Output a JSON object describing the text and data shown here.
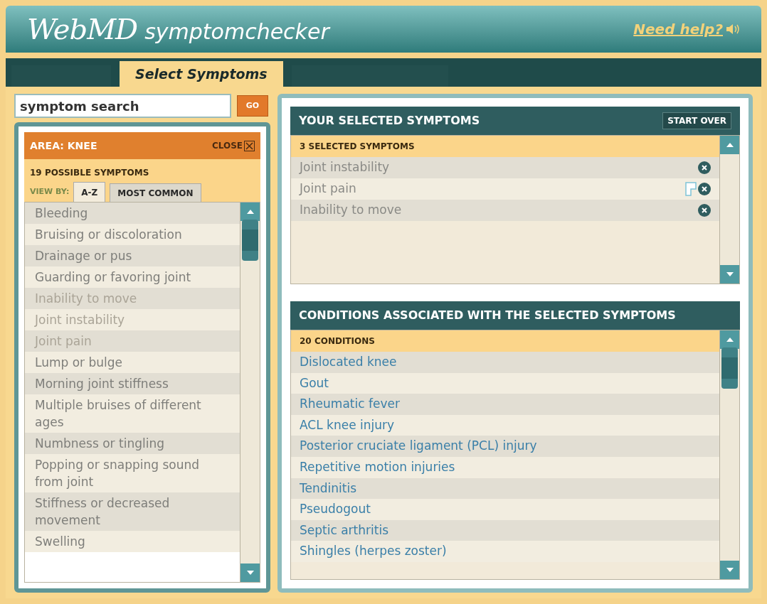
{
  "header": {
    "logo_brand": "WebMD",
    "logo_product": "symptomchecker",
    "help_link": "Need help?"
  },
  "tabs": [
    {
      "selected": false
    },
    {
      "label": "Select Symptoms",
      "selected": true
    },
    {
      "selected": false
    }
  ],
  "search": {
    "value": "symptom search",
    "button": "GO"
  },
  "area_panel": {
    "title": "AREA: KNEE",
    "close": "CLOSE",
    "count": "19 POSSIBLE SYMPTOMS",
    "view_by": "VIEW BY:",
    "view_tabs": [
      {
        "label": "A-Z",
        "selected": true
      },
      {
        "label": "MOST COMMON",
        "selected": false
      }
    ],
    "symptoms": [
      {
        "label": "Bleeding",
        "disabled": false
      },
      {
        "label": "Bruising or discoloration",
        "disabled": false
      },
      {
        "label": "Drainage or pus",
        "disabled": false
      },
      {
        "label": "Guarding or favoring joint",
        "disabled": false
      },
      {
        "label": "Inability to move",
        "disabled": true
      },
      {
        "label": "Joint instability",
        "disabled": true
      },
      {
        "label": "Joint pain",
        "disabled": true
      },
      {
        "label": "Lump or bulge",
        "disabled": false
      },
      {
        "label": "Morning joint stiffness",
        "disabled": false
      },
      {
        "label": "Multiple bruises of different ages",
        "disabled": false
      },
      {
        "label": "Numbness or tingling",
        "disabled": false
      },
      {
        "label": "Popping or snapping sound from joint",
        "disabled": false
      },
      {
        "label": "Stiffness or decreased movement",
        "disabled": false
      },
      {
        "label": "Swelling",
        "disabled": false
      }
    ]
  },
  "selected_panel": {
    "title": "YOUR SELECTED SYMPTOMS",
    "start_over": "START OVER",
    "count": "3 SELECTED SYMPTOMS",
    "items": [
      {
        "label": "Joint instability",
        "flagged": false
      },
      {
        "label": "Joint pain",
        "flagged": true
      },
      {
        "label": "Inability to move",
        "flagged": false
      }
    ]
  },
  "conditions_panel": {
    "title": "CONDITIONS ASSOCIATED WITH THE SELECTED SYMPTOMS",
    "count": "20 CONDITIONS",
    "items": [
      "Dislocated knee",
      "Gout",
      "Rheumatic fever",
      "ACL knee injury",
      "Posterior cruciate ligament (PCL) injury",
      "Repetitive motion injuries",
      "Tendinitis",
      "Pseudogout",
      "Septic arthritis",
      "Shingles (herpes zoster)"
    ]
  }
}
